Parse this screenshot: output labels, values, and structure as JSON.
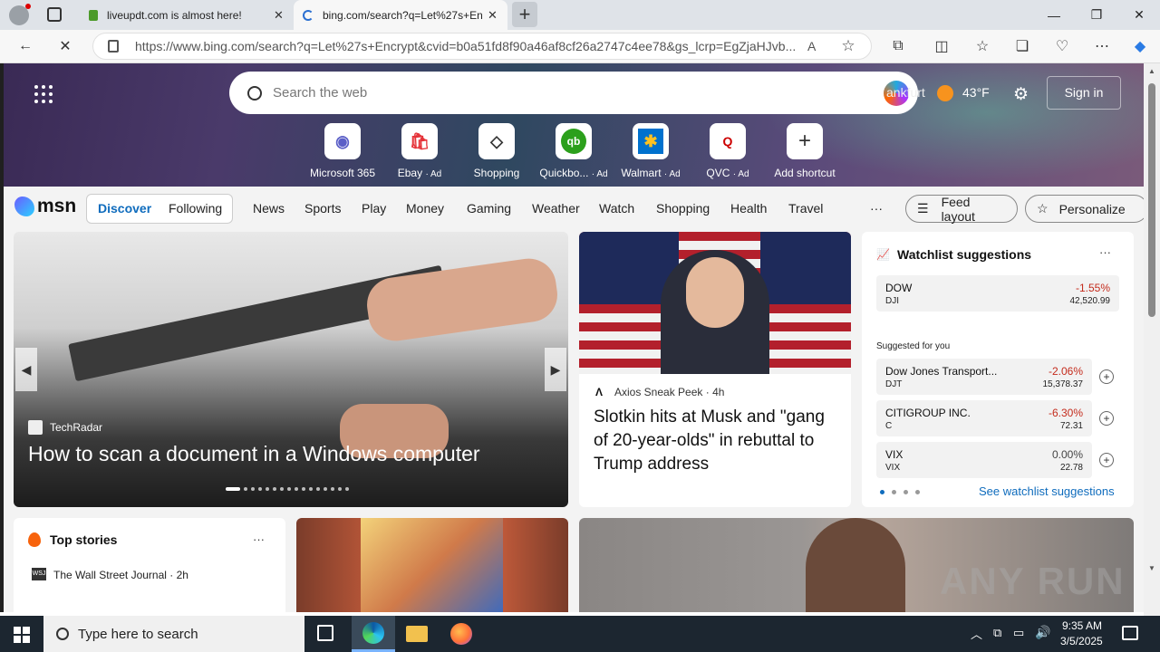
{
  "browser": {
    "tabs": [
      {
        "title": "liveupdt.com is almost here!",
        "close": "✕"
      },
      {
        "title": "bing.com/search?q=Let%27s+Encry",
        "close": "✕"
      }
    ],
    "new_tab": "+",
    "url": "https://www.bing.com/search?q=Let%27s+Encrypt&cvid=b0a51fd8f90a46af8cf26a2747c4ee78&gs_lcrp=EgZjaHJvb...",
    "window": {
      "minimize": "—",
      "maximize": "❐",
      "close": "✕"
    }
  },
  "hero": {
    "search_placeholder": "Search the web",
    "weather_label": "ankfurt",
    "temperature": "43°F",
    "sign_in": "Sign in",
    "shortcuts": [
      {
        "label": "Microsoft 365",
        "ad": ""
      },
      {
        "label": "Ebay",
        "ad": "· Ad"
      },
      {
        "label": "Shopping",
        "ad": ""
      },
      {
        "label": "Quickbo...",
        "ad": "· Ad"
      },
      {
        "label": "Walmart",
        "ad": "· Ad"
      },
      {
        "label": "QVC",
        "ad": "· Ad"
      },
      {
        "label": "Add shortcut",
        "ad": ""
      }
    ]
  },
  "msn": {
    "logo": "msn",
    "tabs": [
      "Discover",
      "Following"
    ],
    "nav": [
      "News",
      "Sports",
      "Play",
      "Money",
      "Gaming",
      "Weather",
      "Watch",
      "Shopping",
      "Health",
      "Travel"
    ],
    "more": "···",
    "feed_layout": "Feed layout",
    "personalize": "Personalize"
  },
  "carousel": {
    "source": "TechRadar",
    "headline": "How to scan a document in a Windows computer"
  },
  "story": {
    "source": "Axios Sneak Peek",
    "age": "· 4h",
    "headline": "Slotkin hits at Musk and \"gang of 20-year-olds\" in rebuttal to Trump address"
  },
  "watchlist": {
    "title": "Watchlist suggestions",
    "menu": "···",
    "main": {
      "name": "DOW",
      "symbol": "DJI",
      "change": "-1.55%",
      "value": "42,520.99"
    },
    "suggested_label": "Suggested for you",
    "items": [
      {
        "name": "Dow Jones Transport...",
        "symbol": "DJT",
        "change": "-2.06%",
        "value": "15,378.37"
      },
      {
        "name": "CITIGROUP INC.",
        "symbol": "C",
        "change": "-6.30%",
        "value": "72.31"
      },
      {
        "name": "VIX",
        "symbol": "VIX",
        "change": "0.00%",
        "value": "22.78"
      }
    ],
    "see_all": "See watchlist suggestions"
  },
  "top_stories": {
    "title": "Top stories",
    "menu": "···",
    "source": "The Wall Street Journal",
    "age": "· 2h"
  },
  "taskbar": {
    "search_placeholder": "Type here to search",
    "time": "9:35 AM",
    "date": "3/5/2025"
  },
  "watermark": "ANY RUN"
}
